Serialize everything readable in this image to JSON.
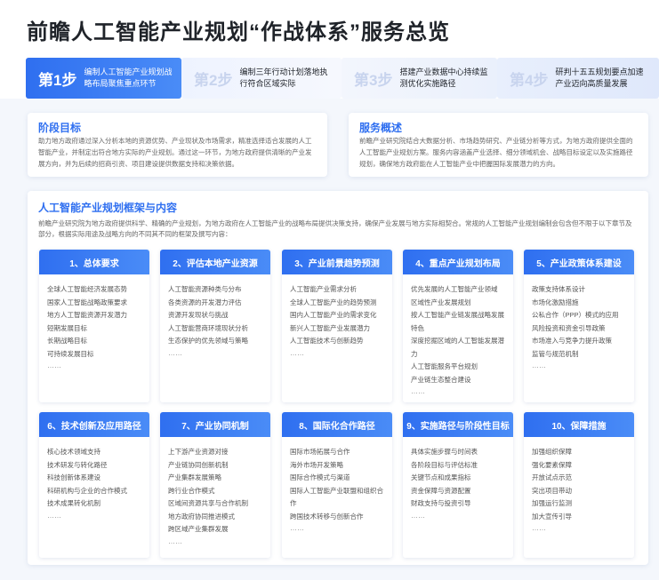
{
  "page": {
    "title": "前瞻人工智能产业规划“作战体系”服务总览"
  },
  "steps": [
    {
      "num": "第1步",
      "desc": "编制人工智能产业规划战略布局聚焦重点环节"
    },
    {
      "num": "第2步",
      "desc": "编制三年行动计划落地执行符合区域实际"
    },
    {
      "num": "第3步",
      "desc": "搭建产业数据中心持续监测优化实施路径"
    },
    {
      "num": "第4步",
      "desc": "研判十五五规划要点加速产业迈向高质量发展"
    }
  ],
  "goal": {
    "title": "阶段目标",
    "text": "助力地方政府通过深入分析本地的资源优势、产业现状及市场需求，精准选择适合发展的人工智能产业，并制定出符合地方实际的产业规划。通过这一环节，为地方政府提供清晰的产业发展方向，并为后续的招商引资、项目建设提供数据支持和决策依据。"
  },
  "overview": {
    "title": "服务概述",
    "text": "前瞻产业研究院结合大数据分析、市场趋势研究、产业链分析等方式，为地方政府提供全面的人工智能产业规划方案。服务内容涵盖产业选择、细分领域机会、战略目标设定以及实施路径规划，确保地方政府能在人工智能产业中把握国际发展潜力的方向。"
  },
  "framework": {
    "title": "人工智能产业规划框架与内容",
    "intro": "前瞻产业研究院为地方政府提供科学、精确的产业规划，为地方政府在人工智能产业的战略布局提供决策支持，确保产业发展与地方实际相契合。常规的人工智能产业规划编制会包含但不限于以下章节及部分，根据实际用途及战略方向的不同其不同的框架及撰写内容：",
    "more": "……",
    "cards": [
      {
        "title": "1、总体要求",
        "items": [
          "全球人工智能经济发展态势",
          "国家人工智能战略政策要求",
          "地方人工智能资源开发潜力",
          "短期发展目标",
          "长期战略目标",
          "可持续发展目标"
        ]
      },
      {
        "title": "2、评估本地产业资源",
        "items": [
          "人工智能资源种类与分布",
          "各类资源的开发潜力评估",
          "资源开发现状与挑战",
          "人工智能营商环境现状分析",
          "生态保护的优先领域与策略"
        ]
      },
      {
        "title": "3、产业前景趋势预测",
        "items": [
          "人工智能产业需求分析",
          "全球人工智能产业的趋势预测",
          "国内人工智能产业的需求变化",
          "新兴人工智能产业发展潜力",
          "人工智能技术与创新趋势"
        ]
      },
      {
        "title": "4、重点产业规划布局",
        "items": [
          "优先发展的人工智能产业领域",
          "区域性产业发展规划",
          "按人工智能产业链发展战略发展特色",
          "深度挖掘区域的人工智能发展潜力",
          "人工智能服务平台规划",
          "产业链生态整合建设"
        ]
      },
      {
        "title": "5、产业政策体系建设",
        "items": [
          "政策支持体系设计",
          "市场化激励措施",
          "公私合作（PPP）模式的应用",
          "风险投资和资金引导政策",
          "市场准入与竞争力提升政策",
          "监管与规范机制"
        ]
      },
      {
        "title": "6、技术创新及应用路径",
        "items": [
          "核心技术领域支持",
          "技术研发与转化路径",
          "科技创新体系建设",
          "科研机构与企业的合作模式",
          "技术成果转化机制"
        ]
      },
      {
        "title": "7、产业协同机制",
        "items": [
          "上下游产业资源对接",
          "产业链协同创新机制",
          "产业集群发展策略",
          "跨行业合作模式",
          "区域间资源共享与合作机制",
          "地方政府协同推进模式",
          "跨区域产业集群发展"
        ]
      },
      {
        "title": "8、国际化合作路径",
        "items": [
          "国际市场拓展与合作",
          "海外市场开发策略",
          "国际合作模式与渠道",
          "国际人工智能产业联盟和组织合作",
          "跨国技术转移与创新合作"
        ]
      },
      {
        "title": "9、实施路径与阶段性目标",
        "items": [
          "具体实施步骤与时间表",
          "各阶段目标与评估标准",
          "关键节点和成果指标",
          "资金保障与资源配置",
          "财政支持与投资引导"
        ]
      },
      {
        "title": "10、保障措施",
        "items": [
          "加强组织保障",
          "强化要素保障",
          "开放试点示范",
          "突出项目带动",
          "加强运行监测",
          "加大宣传引导"
        ]
      }
    ]
  }
}
